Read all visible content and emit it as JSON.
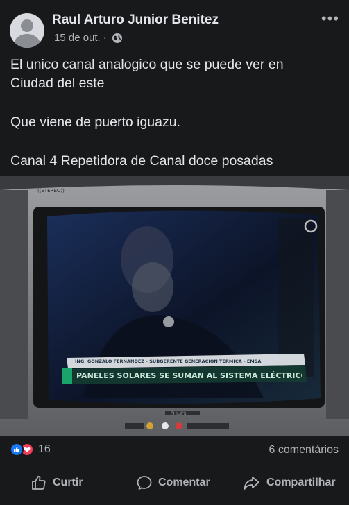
{
  "post": {
    "author": "Raul Arturo Junior Benitez",
    "date": "15 de out.",
    "separator": "·",
    "privacy_icon": "globe-icon",
    "more_icon": "more-options-icon",
    "text_lines": [
      "El unico canal analogico que se puede ver en",
      "Ciudad del este",
      "Que viene de puerto iguazu.",
      "Canal 4 Repetidora de Canal doce posadas"
    ]
  },
  "photo": {
    "tv_brand": "PHILIPS",
    "stereo_label": "((STEREO))",
    "lower_third_name": "ING. GONZALO FERNANDEZ - SUBGERENTE GENERACION TÉRMICA - EMSA",
    "lower_third_headline": "PANELES SOLARES SE SUMAN AL SISTEMA ELÉCTRICO"
  },
  "stats": {
    "reaction_count": "16",
    "comments": "6 comentários",
    "reaction_icons": [
      "like-icon",
      "love-icon"
    ]
  },
  "actions": {
    "like": "Curtir",
    "comment": "Comentar",
    "share": "Compartilhar"
  },
  "colors": {
    "background": "#18191a",
    "text_primary": "#e4e6eb",
    "text_secondary": "#b0b3b8",
    "like_blue": "#1877f2",
    "love_red": "#f33e58"
  }
}
